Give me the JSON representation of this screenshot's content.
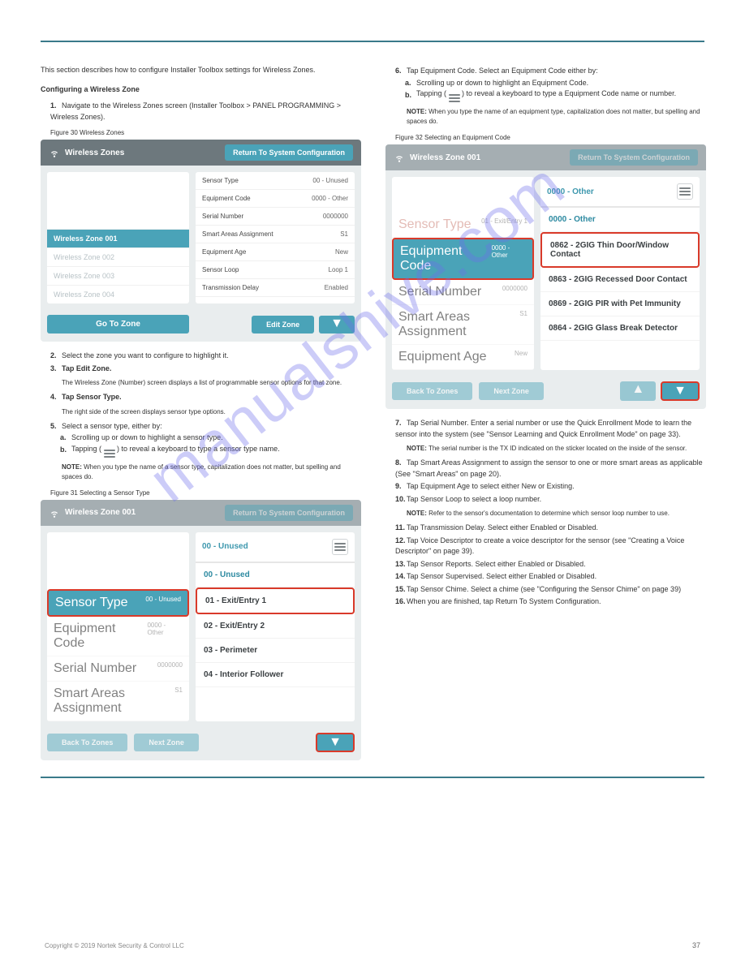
{
  "watermark": "manualshive.com",
  "page_number": "37",
  "publisher": "Copyright © 2019 Nortek Security & Control LLC",
  "left_column": {
    "intro": "This section describes how to configure Installer Toolbox settings for Wireless Zones.",
    "steps_title": "Configuring a Wireless Zone",
    "step1": {
      "n": "1.",
      "t": "Navigate to the Wireless Zones screen (Installer Toolbox > PANEL PROGRAMMING > Wireless Zones)."
    },
    "fig1_cap": "Figure 30 Wireless Zones",
    "step2": {
      "n": "2.",
      "t": "Select the zone you want to configure to highlight it."
    },
    "step3": {
      "n": "3.",
      "t": "Tap Edit Zone."
    },
    "step3_note": "The Wireless Zone (Number) screen displays a list of programmable sensor options for that zone.",
    "step4": {
      "n": "4.",
      "t": "Tap Sensor Type."
    },
    "step4_note": "The right side of the screen displays sensor type options.",
    "step5": {
      "n": "5.",
      "t": "Select a sensor type, either by:"
    },
    "step5a": {
      "l": "a.",
      "t": "Scrolling up or down to highlight a sensor type."
    },
    "step5b": {
      "l": "b.",
      "t": "Tapping (        ) to reveal a keyboard to type a sensor type name."
    },
    "step5_note": "NOTE: When you type the name of a sensor type, capitalization does not matter, but spelling and spaces do.",
    "fig2_cap": "Figure 31 Selecting a Sensor Type"
  },
  "right_column": {
    "step6": {
      "n": "6.",
      "t": "Tap Equipment Code. Select an Equipment Code either by:"
    },
    "step6a": {
      "l": "a.",
      "t": "Scrolling up or down to highlight an Equipment Code."
    },
    "step6b": {
      "l": "b.",
      "t": "Tapping (        ) to reveal a keyboard to type a Equipment Code name or number."
    },
    "step6_note": "NOTE: When you type the name of an equipment type, capitalization does not matter, but spelling and spaces do.",
    "fig3_cap": "Figure 32 Selecting an Equipment Code",
    "step7": {
      "n": "7.",
      "t": "Tap Serial Number. Enter a serial number or use the Quick Enrollment Mode to learn the sensor into the system (see \"Sensor Learning and Quick Enrollment Mode\" on page 33)."
    },
    "step7_note": "NOTE: The serial number is the TX ID indicated on the sticker located on the inside of the sensor.",
    "step8": {
      "n": "8.",
      "t": "Tap Smart Areas Assignment to assign the sensor to one or more smart areas as applicable (See \"Smart Areas\" on page 20)."
    },
    "step9": {
      "n": "9.",
      "t": "Tap Equipment Age to select either New or Existing."
    },
    "step10": {
      "n": "10.",
      "t": "Tap Sensor Loop to select a loop number."
    },
    "step10_note": "NOTE: Refer to the sensor's documentation to determine which sensor loop number to use.",
    "step11": {
      "n": "11.",
      "t": "Tap Transmission Delay. Select either Enabled or Disabled."
    },
    "step12": {
      "n": "12.",
      "t": "Tap Voice Descriptor to create a voice descriptor for the sensor (see \"Creating a Voice Descriptor\" on page 39)."
    },
    "step13": {
      "n": "13.",
      "t": "Tap Sensor Reports. Select either Enabled or Disabled."
    },
    "step14": {
      "n": "14.",
      "t": "Tap Sensor Supervised. Select either Enabled or Disabled."
    },
    "step15": {
      "n": "15.",
      "t": "Tap Sensor Chime. Select a chime (see \"Configuring the Sensor Chime\" on page 39)"
    },
    "step16": {
      "n": "16.",
      "t": "When you are finished, tap Return To System Configuration."
    }
  },
  "shot1": {
    "title": "Wireless Zones",
    "return_btn": "Return To System Configuration",
    "zones": {
      "z0": "Wireless Zone 001",
      "z1": "Wireless Zone 002",
      "z2": "Wireless Zone 003",
      "z3": "Wireless Zone 004"
    },
    "props": [
      {
        "k": "Sensor Type",
        "v": "00 - Unused"
      },
      {
        "k": "Equipment Code",
        "v": "0000 - Other"
      },
      {
        "k": "Serial Number",
        "v": "0000000"
      },
      {
        "k": "Smart Areas Assignment",
        "v": "S1"
      },
      {
        "k": "Equipment Age",
        "v": "New"
      },
      {
        "k": "Sensor Loop",
        "v": "Loop 1"
      },
      {
        "k": "Transmission Delay",
        "v": "Enabled"
      }
    ],
    "go_btn": "Go To Zone",
    "edit_btn": "Edit Zone"
  },
  "shot2": {
    "title": "Wireless Zone 001",
    "return_btn": "Return To System Configuration",
    "props": [
      {
        "k": "Sensor Type",
        "v": "00 - Unused"
      },
      {
        "k": "Equipment Code",
        "v": "0000 - Other"
      },
      {
        "k": "Serial Number",
        "v": "0000000"
      },
      {
        "k": "Smart Areas Assignment",
        "v": "S1"
      }
    ],
    "sel_label": "00 - Unused",
    "opts": [
      "00 - Unused",
      "01 - Exit/Entry 1",
      "02 - Exit/Entry 2",
      "03 - Perimeter",
      "04 - Interior Follower"
    ],
    "back_btn": "Back To Zones",
    "next_btn": "Next Zone"
  },
  "shot3": {
    "title": "Wireless Zone 001",
    "return_btn": "Return To System Configuration",
    "props": [
      {
        "k": "Sensor Type",
        "v": "01 - Exit/Entry 1"
      },
      {
        "k": "Equipment Code",
        "v": "0000 - Other"
      },
      {
        "k": "Serial Number",
        "v": "0000000"
      },
      {
        "k": "Smart Areas Assignment",
        "v": "S1"
      },
      {
        "k": "Equipment Age",
        "v": "New"
      }
    ],
    "sel_label": "0000 - Other",
    "opts": [
      "0000 - Other",
      "0862 - 2GIG Thin Door/Window Contact",
      "0863 - 2GIG Recessed Door Contact",
      "0869 - 2GIG PIR with Pet Immunity",
      "0864 - 2GIG Glass Break Detector"
    ],
    "back_btn": "Back To Zones",
    "next_btn": "Next Zone"
  }
}
